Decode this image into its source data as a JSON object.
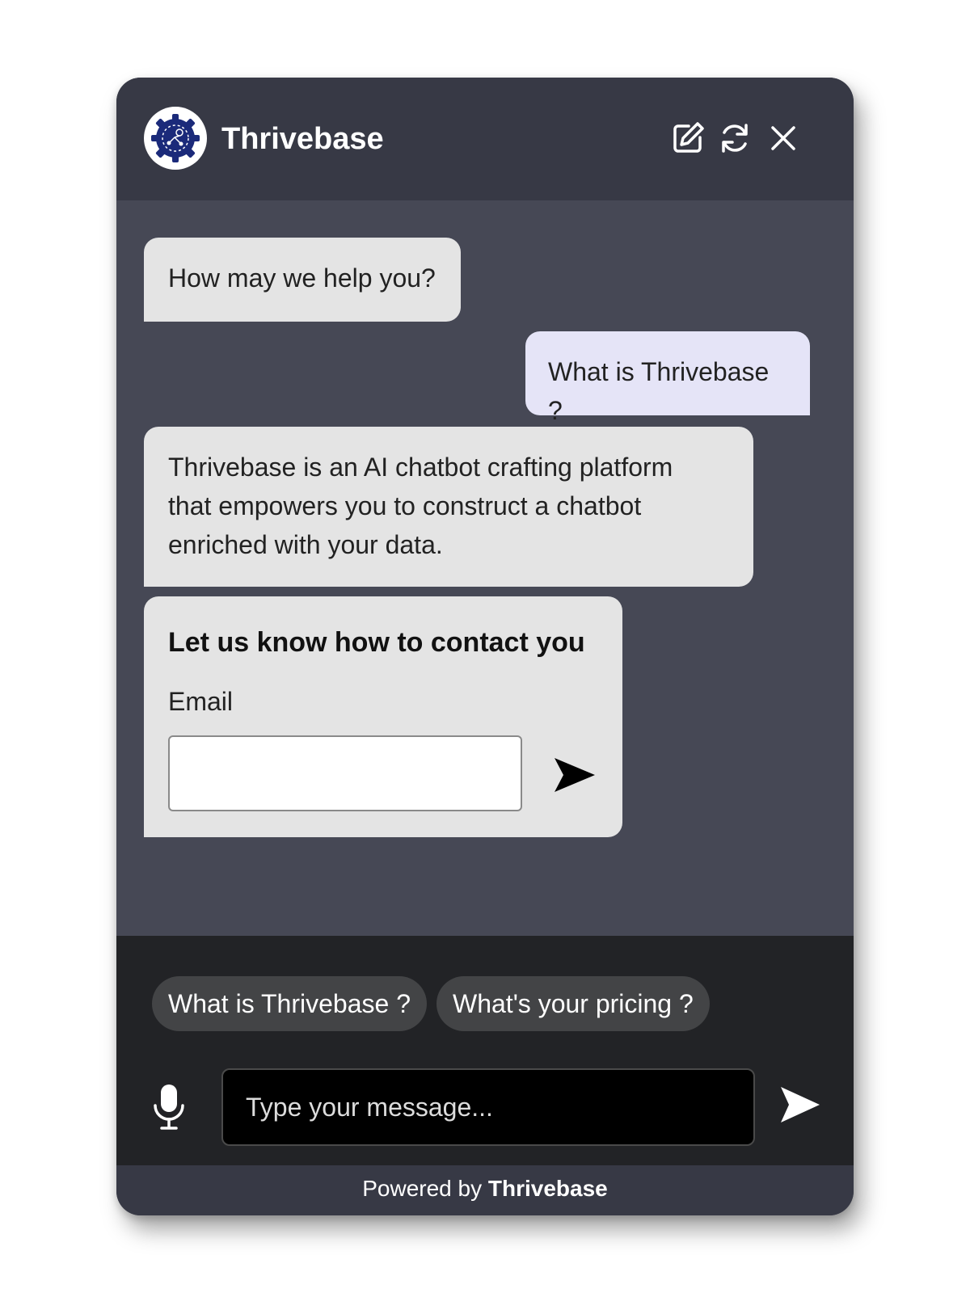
{
  "header": {
    "title": "Thrivebase",
    "logo_icon": "gear-circuit-logo",
    "buttons": {
      "edit_icon": "edit-icon",
      "refresh_icon": "refresh-icon",
      "close_icon": "close-icon"
    }
  },
  "messages": [
    {
      "sender": "bot",
      "text": "How may we help you?"
    },
    {
      "sender": "user",
      "text": "What is Thrivebase ?"
    },
    {
      "sender": "bot",
      "lines": [
        "Thrivebase is an AI chatbot crafting platform",
        "that empowers you to construct a chatbot",
        "enriched with your data."
      ]
    }
  ],
  "contact_form": {
    "title": "Let us know how to contact you",
    "email_label": "Email",
    "email_value": "",
    "send_icon": "send-arrow-icon"
  },
  "suggestions": [
    "What is Thrivebase ?",
    "What's your pricing ?"
  ],
  "composer": {
    "placeholder": "Type your message...",
    "mic_icon": "microphone-icon",
    "send_icon": "send-icon"
  },
  "footer": {
    "powered_prefix": "Powered by",
    "powered_brand": "Thrivebase"
  },
  "colors": {
    "header_bg": "#373945",
    "chat_bg": "#464855",
    "bot_bubble": "#e4e4e4",
    "user_bubble": "#e5e4f7",
    "composer_bg": "#222326",
    "logo_blue": "#1b2a7a"
  }
}
